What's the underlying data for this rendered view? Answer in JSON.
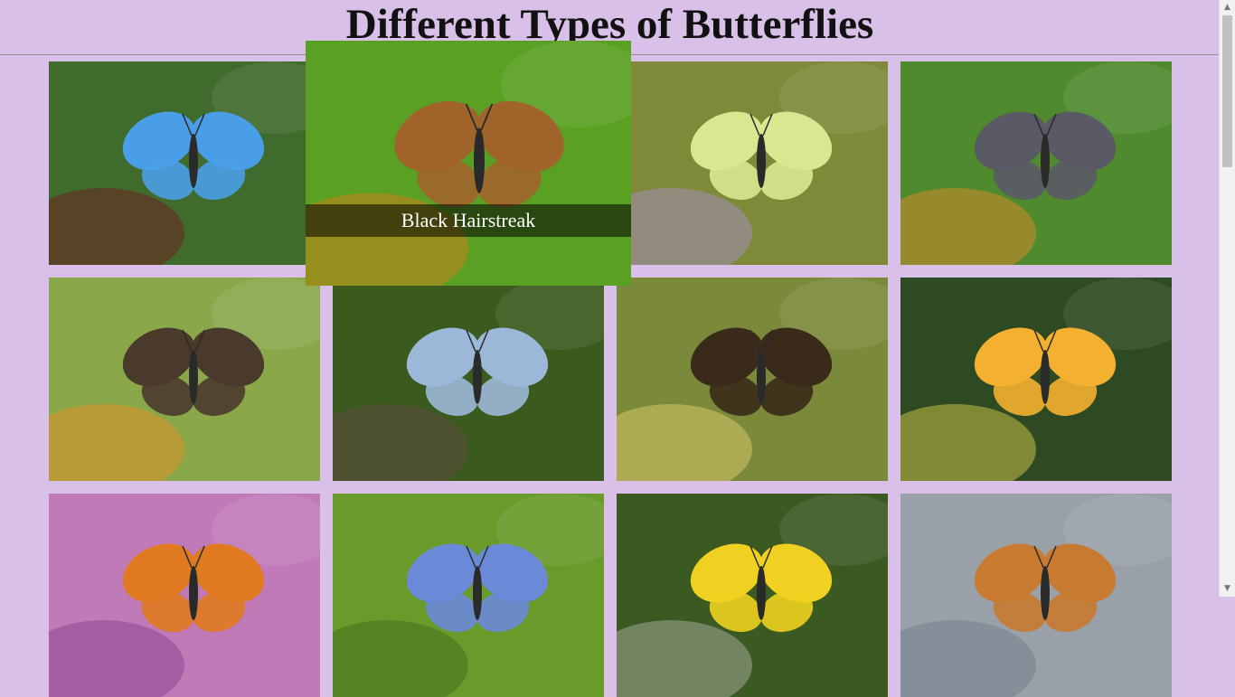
{
  "page": {
    "title": "Different Types of Butterflies"
  },
  "hovered_caption": "Black Hairstreak",
  "butterflies": [
    {
      "bg": "#3f6b2c",
      "accent": "#4a9ee8",
      "accent2": "#7a1520",
      "icon": "adonis-blue"
    },
    {
      "bg": "#5aa022",
      "accent": "#a0642a",
      "accent2": "#e07a1a",
      "icon": "black-hairstreak"
    },
    {
      "bg": "#7e8a3a",
      "accent": "#d8e890",
      "accent2": "#a98fd0",
      "icon": "brimstone"
    },
    {
      "bg": "#4f8a2e",
      "accent": "#5a5a66",
      "accent2": "#f08a2a",
      "icon": "brown-argus"
    },
    {
      "bg": "#8aa84a",
      "accent": "#4a3a2c",
      "accent2": "#f08a20",
      "icon": "brown-hairstreak"
    },
    {
      "bg": "#3a5a1e",
      "accent": "#9cb8d8",
      "accent2": "#6a4a4a",
      "icon": "chalkhill-blue"
    },
    {
      "bg": "#7a8a3a",
      "accent": "#3a2a1a",
      "accent2": "#e8d070",
      "icon": "chequered-skipper"
    },
    {
      "bg": "#2e4a22",
      "accent": "#f4b030",
      "accent2": "#e8d850",
      "icon": "clouded-yellow"
    },
    {
      "bg": "#c07ab8",
      "accent": "#e07a20",
      "accent2": "#8a3a8a",
      "icon": "comma"
    },
    {
      "bg": "#6a9a2a",
      "accent": "#6a8ad8",
      "accent2": "#3a6a1a",
      "icon": "common-blue"
    },
    {
      "bg": "#3a5a22",
      "accent": "#f0d020",
      "accent2": "#b8b8b0",
      "icon": "dingy-skipper"
    },
    {
      "bg": "#9aa0a8",
      "accent": "#c87a30",
      "accent2": "#6a7a8a",
      "icon": "fritillary"
    }
  ]
}
